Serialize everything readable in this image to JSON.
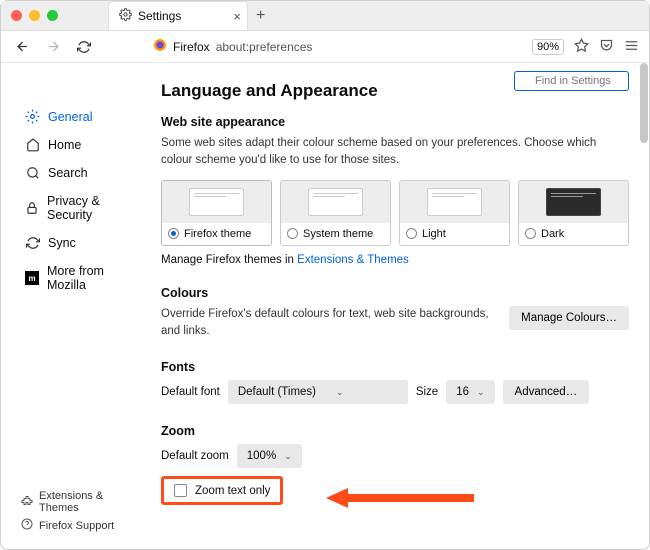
{
  "window": {
    "tab_title": "Settings",
    "url_domain": "Firefox",
    "url_path": "about:preferences",
    "zoom": "90%"
  },
  "search": {
    "placeholder": "Find in Settings"
  },
  "sidebar": {
    "items": [
      {
        "label": "General",
        "icon": "gear"
      },
      {
        "label": "Home",
        "icon": "home"
      },
      {
        "label": "Search",
        "icon": "search"
      },
      {
        "label": "Privacy & Security",
        "icon": "lock"
      },
      {
        "label": "Sync",
        "icon": "sync"
      },
      {
        "label": "More from Mozilla",
        "icon": "mozilla"
      }
    ],
    "bottom": {
      "ext": "Extensions & Themes",
      "support": "Firefox Support"
    }
  },
  "main": {
    "heading": "Language and Appearance",
    "appearance": {
      "title": "Web site appearance",
      "desc": "Some web sites adapt their colour scheme based on your preferences. Choose which colour scheme you'd like to use for those sites.",
      "themes": [
        {
          "label": "Firefox theme",
          "selected": true,
          "dark": false
        },
        {
          "label": "System theme",
          "selected": false,
          "dark": false
        },
        {
          "label": "Light",
          "selected": false,
          "dark": false
        },
        {
          "label": "Dark",
          "selected": false,
          "dark": true
        }
      ],
      "manage_pre": "Manage Firefox themes in ",
      "manage_link": "Extensions & Themes"
    },
    "colours": {
      "title": "Colours",
      "desc": "Override Firefox's default colours for text, web site backgrounds, and links.",
      "button": "Manage Colours…"
    },
    "fonts": {
      "title": "Fonts",
      "default_label": "Default font",
      "default_value": "Default (Times)",
      "size_label": "Size",
      "size_value": "16",
      "advanced": "Advanced…"
    },
    "zoom": {
      "title": "Zoom",
      "default_label": "Default zoom",
      "default_value": "100%",
      "checkbox_label": "Zoom text only"
    }
  }
}
